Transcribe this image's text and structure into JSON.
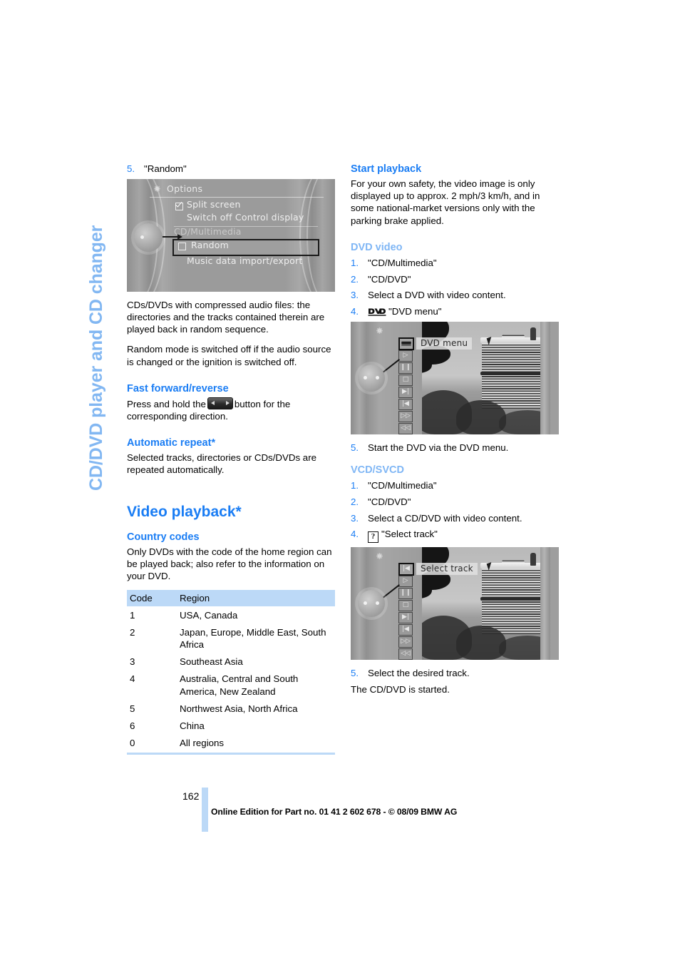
{
  "running_head": "CD/DVD player and CD changer",
  "left_column": {
    "step5_random": {
      "num": "5.",
      "text": "\"Random\""
    },
    "screenshot_options": {
      "title": "Options",
      "gear_icon": "gear-icon",
      "items": [
        {
          "label": "Split screen",
          "checkbox": "checked"
        },
        {
          "label": "Switch off Control display",
          "checkbox": "none"
        },
        {
          "label": "CD/Multimedia",
          "checkbox": "none",
          "dim": true
        },
        {
          "label": "Random",
          "checkbox": "unchecked",
          "selected": true
        },
        {
          "label": "Music data import/export",
          "checkbox": "none"
        }
      ]
    },
    "para_compressed": "CDs/DVDs with compressed audio files: the directories and the tracks contained therein are played back in random sequence.",
    "para_random_off": "Random mode is switched off if the audio source is changed or the ignition is switched off.",
    "fast_forward": {
      "heading": "Fast forward/reverse",
      "text_before": "Press and hold the",
      "button_icon": "fast-forward-reverse-button-icon",
      "text_after": "button for the corresponding direction."
    },
    "automatic_repeat": {
      "heading": "Automatic repeat*",
      "text": "Selected tracks, directories or CDs/DVDs are repeated automatically."
    },
    "video_playback": {
      "heading": "Video playback*",
      "country_codes": {
        "heading": "Country codes",
        "text": "Only DVDs with the code of the home region can be played back; also refer to the information on your DVD.",
        "columns": [
          "Code",
          "Region"
        ],
        "rows": [
          [
            "1",
            "USA, Canada"
          ],
          [
            "2",
            "Japan, Europe, Middle East, South Africa"
          ],
          [
            "3",
            "Southeast Asia"
          ],
          [
            "4",
            "Australia, Central and South America, New Zealand"
          ],
          [
            "5",
            "Northwest Asia, North Africa"
          ],
          [
            "6",
            "China"
          ],
          [
            "0",
            "All regions"
          ]
        ]
      }
    }
  },
  "right_column": {
    "start_playback": {
      "heading": "Start playback",
      "text": "For your own safety, the video image is only displayed up to approx. 2 mph/3 km/h, and in some national-market versions only with the parking brake applied."
    },
    "dvd_video": {
      "heading": "DVD video",
      "steps": [
        {
          "num": "1.",
          "text": "\"CD/Multimedia\""
        },
        {
          "num": "2.",
          "text": "\"CD/DVD\""
        },
        {
          "num": "3.",
          "text": "Select a DVD with video content."
        },
        {
          "num": "4.",
          "icon": "dvd-logo-icon",
          "text": "\"DVD menu\""
        }
      ],
      "screenshot": {
        "label": "DVD menu",
        "selected_button_icon": "dvd-logo-icon",
        "buttons": [
          "dvd-logo-icon",
          "play-icon",
          "pause-icon",
          "stop-icon",
          "next-track-icon",
          "previous-track-icon",
          "fast-forward-icon",
          "rewind-icon"
        ]
      },
      "step5": {
        "num": "5.",
        "text": "Start the DVD via the DVD menu."
      }
    },
    "vcd_svcd": {
      "heading": "VCD/SVCD",
      "steps": [
        {
          "num": "1.",
          "text": "\"CD/Multimedia\""
        },
        {
          "num": "2.",
          "text": "\"CD/DVD\""
        },
        {
          "num": "3.",
          "text": "Select a CD/DVD with video content."
        },
        {
          "num": "4.",
          "icon": "select-track-icon",
          "text": "\"Select track\""
        }
      ],
      "screenshot": {
        "label": "Select track",
        "selected_button_icon": "select-track-icon",
        "buttons": [
          "select-track-icon",
          "play-icon",
          "pause-icon",
          "stop-icon",
          "next-track-icon",
          "previous-track-icon",
          "fast-forward-icon",
          "rewind-icon"
        ]
      },
      "step5": {
        "num": "5.",
        "text": "Select the desired track."
      },
      "closing": "The CD/DVD is started."
    }
  },
  "footer": {
    "page_number": "162",
    "imprint": "Online Edition for Part no. 01 41 2 602 678 - © 08/09 BMW AG"
  },
  "colors": {
    "heading_blue": "#1a7df4",
    "subheading_light_blue": "#7fb6f5",
    "running_head_blue": "#82b7f2",
    "table_band": "#bcd9f7"
  }
}
